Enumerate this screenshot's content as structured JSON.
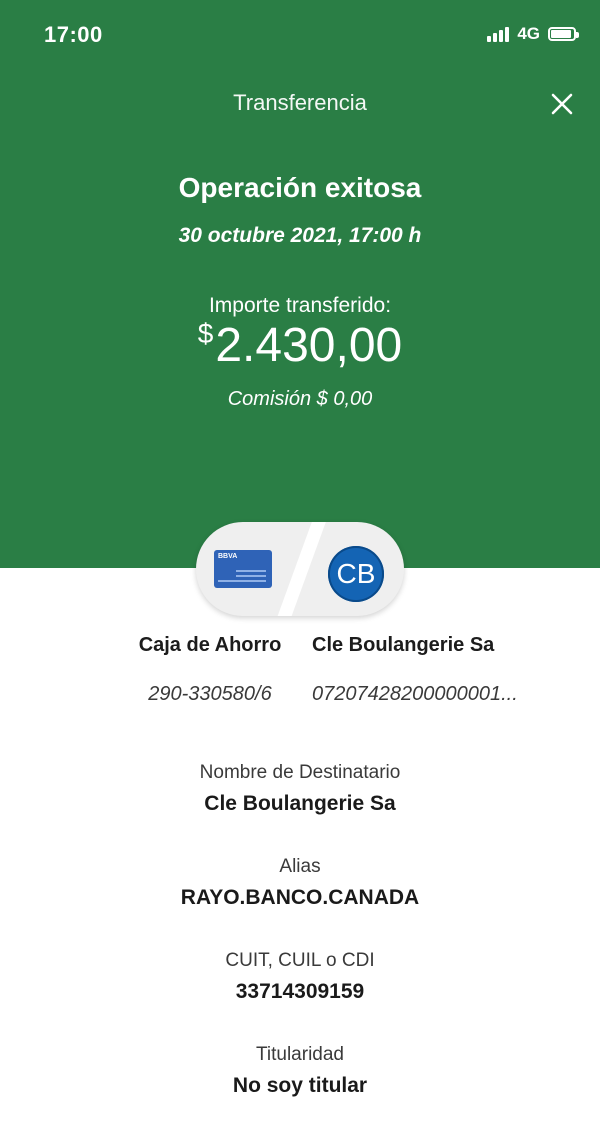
{
  "status_bar": {
    "time": "17:00",
    "network": "4G"
  },
  "header": {
    "title": "Transferencia",
    "status": "Operación exitosa",
    "datetime": "30 octubre 2021, 17:00 h",
    "amount_label": "Importe transferido:",
    "currency": "$",
    "amount": "2.430,00",
    "commission": "Comisión  $ 0,00",
    "background_color": "#2a7e45"
  },
  "transfer": {
    "origin": {
      "icon": "bank-card-icon",
      "card_brand": "BBVA",
      "name": "Caja de Ahorro",
      "account": "290-330580/6"
    },
    "destination": {
      "initials": "CB",
      "name": "Cle Boulangerie Sa",
      "account": "07207428200000001..."
    }
  },
  "details": [
    {
      "label": "Nombre de Destinatario",
      "value": "Cle Boulangerie Sa"
    },
    {
      "label": "Alias",
      "value": "RAYO.BANCO.CANADA"
    },
    {
      "label": "CUIT, CUIL o CDI",
      "value": "33714309159"
    },
    {
      "label": "Titularidad",
      "value": "No soy titular"
    }
  ]
}
